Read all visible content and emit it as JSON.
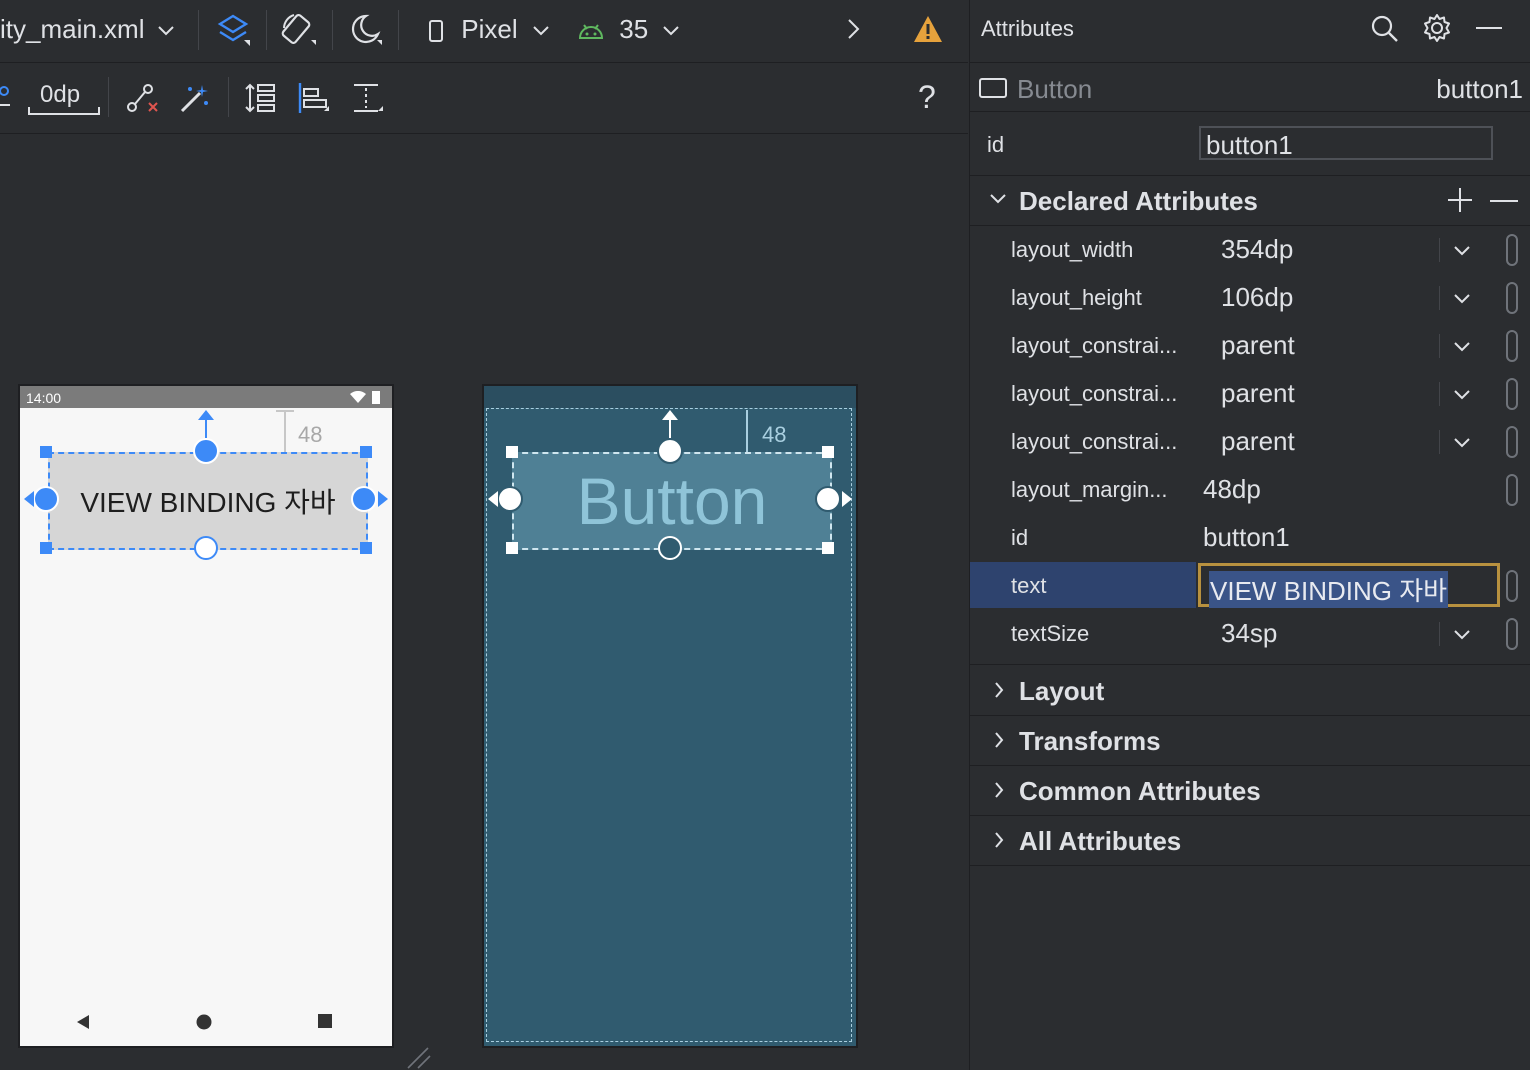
{
  "toolbar": {
    "file_name": "ity_main.xml",
    "device": "Pixel",
    "api_level": "35",
    "margin_value": "0dp",
    "help": "?"
  },
  "phone": {
    "status_time": "14:00",
    "margin_label": "48",
    "button_text": "VIEW BINDING 자바"
  },
  "blueprint": {
    "margin_label": "48",
    "button_text": "Button"
  },
  "attributes": {
    "title": "Attributes",
    "component_type": "Button",
    "component_id": "button1",
    "id_label": "id",
    "id_value": "button1",
    "declared_title": "Declared Attributes",
    "rows": [
      {
        "label": "layout_width",
        "value": "354dp"
      },
      {
        "label": "layout_height",
        "value": "106dp"
      },
      {
        "label": "layout_constrai...",
        "value": "parent"
      },
      {
        "label": "layout_constrai...",
        "value": "parent"
      },
      {
        "label": "layout_constrai...",
        "value": "parent"
      },
      {
        "label": "layout_margin...",
        "value": "48dp"
      },
      {
        "label": "id",
        "value": "button1"
      },
      {
        "label": "text",
        "value": "VIEW BINDING 자바"
      },
      {
        "label": "textSize",
        "value": "34sp"
      }
    ],
    "sections": [
      "Layout",
      "Transforms",
      "Common Attributes",
      "All Attributes"
    ]
  },
  "colors": {
    "accent_blue": "#3d8af7",
    "selection_row": "#2e436e",
    "edit_border": "#b8913f",
    "blueprint_bg": "#305b6f",
    "warning": "#e6a23c",
    "android_green": "#5fb85f"
  }
}
